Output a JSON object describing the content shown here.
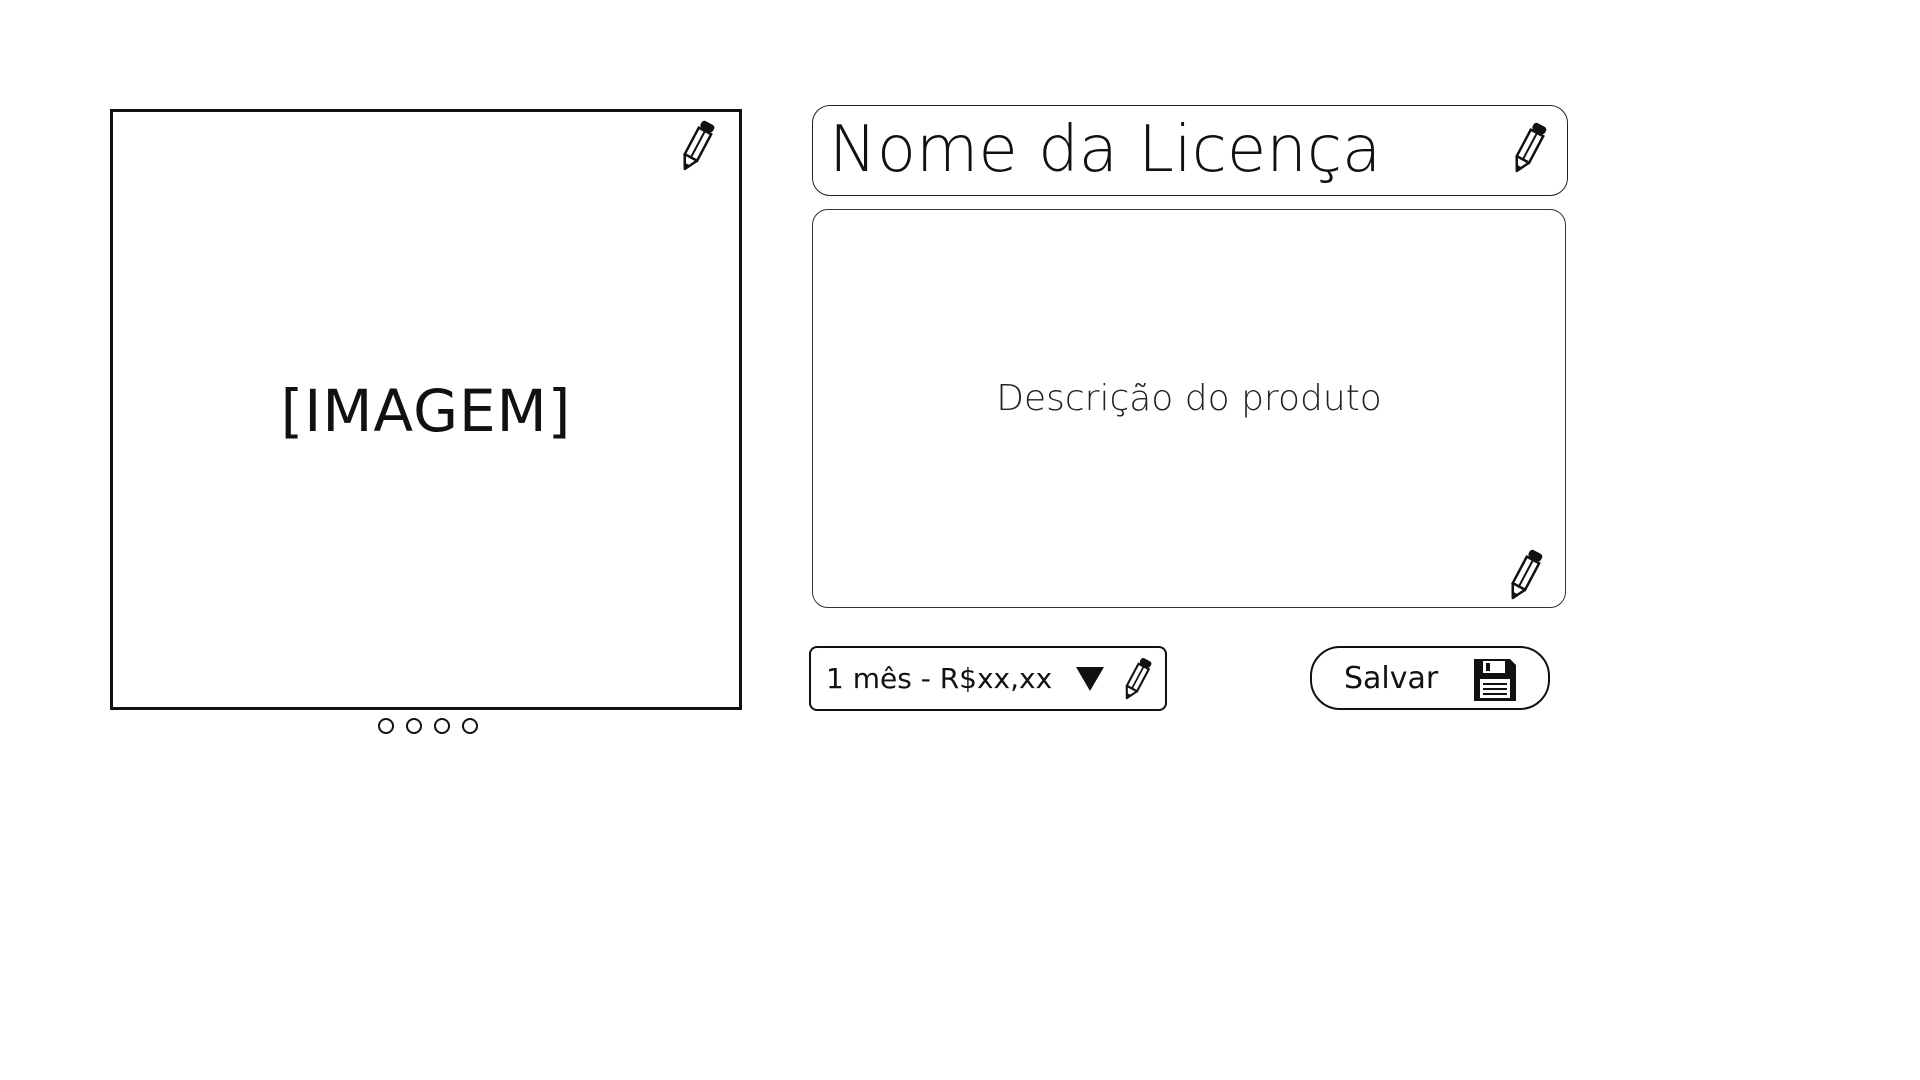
{
  "image_panel": {
    "placeholder": "[IMAGEM]",
    "edit_icon": "pencil-icon",
    "carousel_dots": 4
  },
  "license": {
    "name": "Nome da Licença",
    "edit_icon": "pencil-icon"
  },
  "description": {
    "text": "Descrição do produto",
    "edit_icon": "pencil-icon"
  },
  "plan": {
    "selected": "1 mês - R$xx,xx",
    "arrow_icon": "dropdown-arrow-icon",
    "edit_icon": "pencil-icon"
  },
  "save": {
    "label": "Salvar",
    "icon": "floppy-disk-icon"
  }
}
